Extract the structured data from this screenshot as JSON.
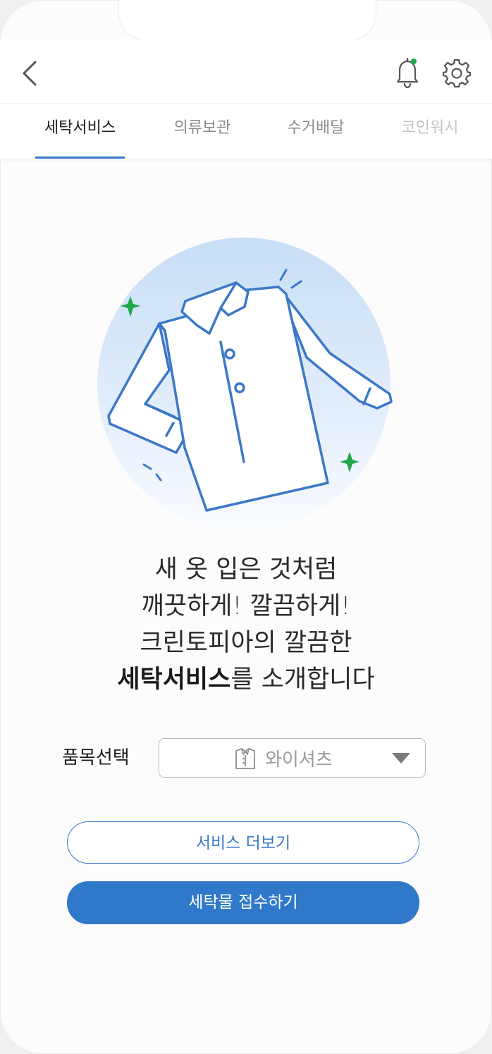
{
  "tabs": [
    {
      "label": "세탁서비스",
      "active": true
    },
    {
      "label": "의류보관",
      "active": false
    },
    {
      "label": "수거배달",
      "active": false
    },
    {
      "label": "코인워시",
      "active": false
    }
  ],
  "header": {
    "back_icon": "chevron-left-icon",
    "notification_icon": "bell-icon",
    "notification_dot_color": "#1fa84a",
    "settings_icon": "gear-icon"
  },
  "hero": {
    "illustration": "shirt-illustration",
    "sparkle_color": "#1fa84a",
    "outline_color": "#3b78c8"
  },
  "headline": {
    "line1": "새 옷 입은 것처럼",
    "line2": "깨끗하게! 깔끔하게!",
    "line3": "크린토피아의 깔끔한",
    "line4_bold": "세탁서비스",
    "line4_rest": "를 소개합니다"
  },
  "item_select": {
    "label": "품목선택",
    "value": "와이셔츠",
    "icon": "shirt-icon"
  },
  "buttons": {
    "more": "서비스 더보기",
    "submit": "세탁물 접수하기"
  },
  "colors": {
    "accent": "#3b78c8",
    "primary_button": "#3078c9"
  }
}
